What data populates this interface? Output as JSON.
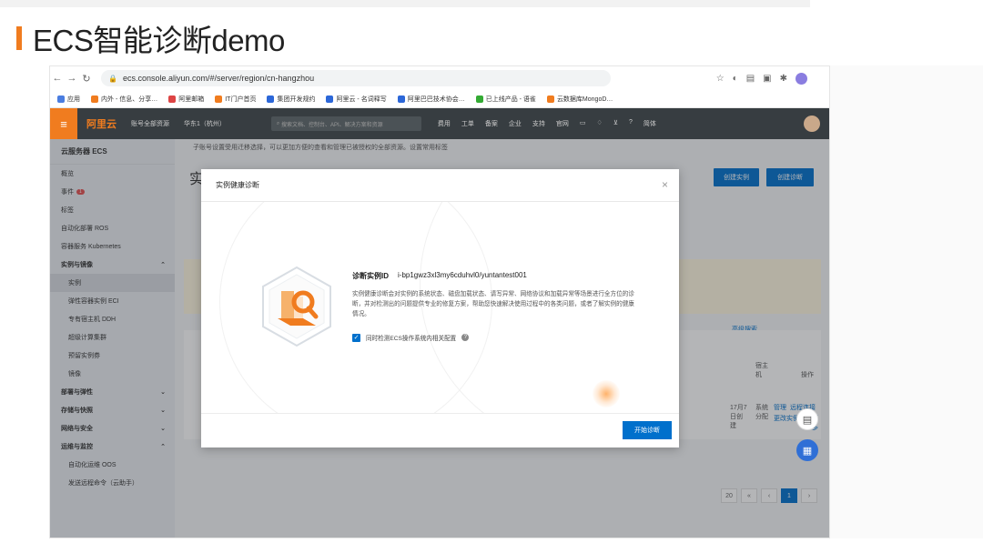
{
  "slide": {
    "title": "ECS智能诊断demo"
  },
  "browser": {
    "url": "ecs.console.aliyun.com/#/server/region/cn-hangzhou",
    "bookmarks": [
      "应用",
      "内外 - 信息、分享…",
      "阿里邮箱",
      "IT门户首页",
      "集团开发规约",
      "阿里云 - 名词释写",
      "阿里巴巴技术协会…",
      "已上线产品 - 语雀",
      "云数据库MongoD…"
    ]
  },
  "console": {
    "logo": "阿里云",
    "account_scope": "账号全部资源",
    "region": "华东1（杭州）",
    "search_placeholder": "搜索文档、控制台、API、解决方案和资源",
    "top_links": [
      "费用",
      "工单",
      "备案",
      "企业",
      "支持",
      "官网"
    ],
    "lang": "简体"
  },
  "sidebar": {
    "title": "云服务器 ECS",
    "items": [
      {
        "label": "概览"
      },
      {
        "label": "事件",
        "badge": "1"
      },
      {
        "label": "标签"
      },
      {
        "label": "自动化部署 ROS"
      },
      {
        "label": "容器服务 Kubernetes"
      }
    ],
    "group_instances": "实例与镜像",
    "instance_items": [
      "实例",
      "弹性容器实例 ECI",
      "专有宿主机 DDH",
      "超级计算集群",
      "预留实例券",
      "镜像"
    ],
    "groups": [
      "部署与弹性",
      "存储与快照",
      "网络与安全",
      "运维与监控"
    ],
    "ops_items": [
      "自动化运维 OOS",
      "发送远程命令（云助手）"
    ]
  },
  "main": {
    "notice": "子账号设置受用迁移选择，可以更加方便的查看和管理已被授权的全部资源。设置常用标签",
    "page_heading": "实",
    "create_instance": "创建实例",
    "create_diagnosis": "创建诊断",
    "advanced_search": "高级搜索",
    "col_host": "宿主机",
    "col_ops": "操作",
    "row_system": "系统分配",
    "row_manage": "管理",
    "row_remote": "远程连接",
    "row_change": "更改实例规格",
    "row_more": "更多",
    "row_date": "17月7日创建",
    "page_size": "20",
    "page_num": "1"
  },
  "modal": {
    "title": "实例健康诊断",
    "id_label": "诊断实例ID",
    "id_value": "i-bp1gwz3xl3my6cduhvl0/yuntantest001",
    "description": "实例健康诊断会对实例的系统状态、磁盘加载状态、请写异常、网络协议和加载异常等场景进行全方位的诊断，并对检测出的问题提供专业的修复方案，帮助您快速解决使用过程中的各类问题，或者了解实例的健康情况。",
    "checkbox_label": "同时检测ECS操作系统内相关配置",
    "start_button": "开始诊断"
  },
  "colors": {
    "accent_orange": "#f07c1f",
    "primary_blue": "#0070cc"
  }
}
